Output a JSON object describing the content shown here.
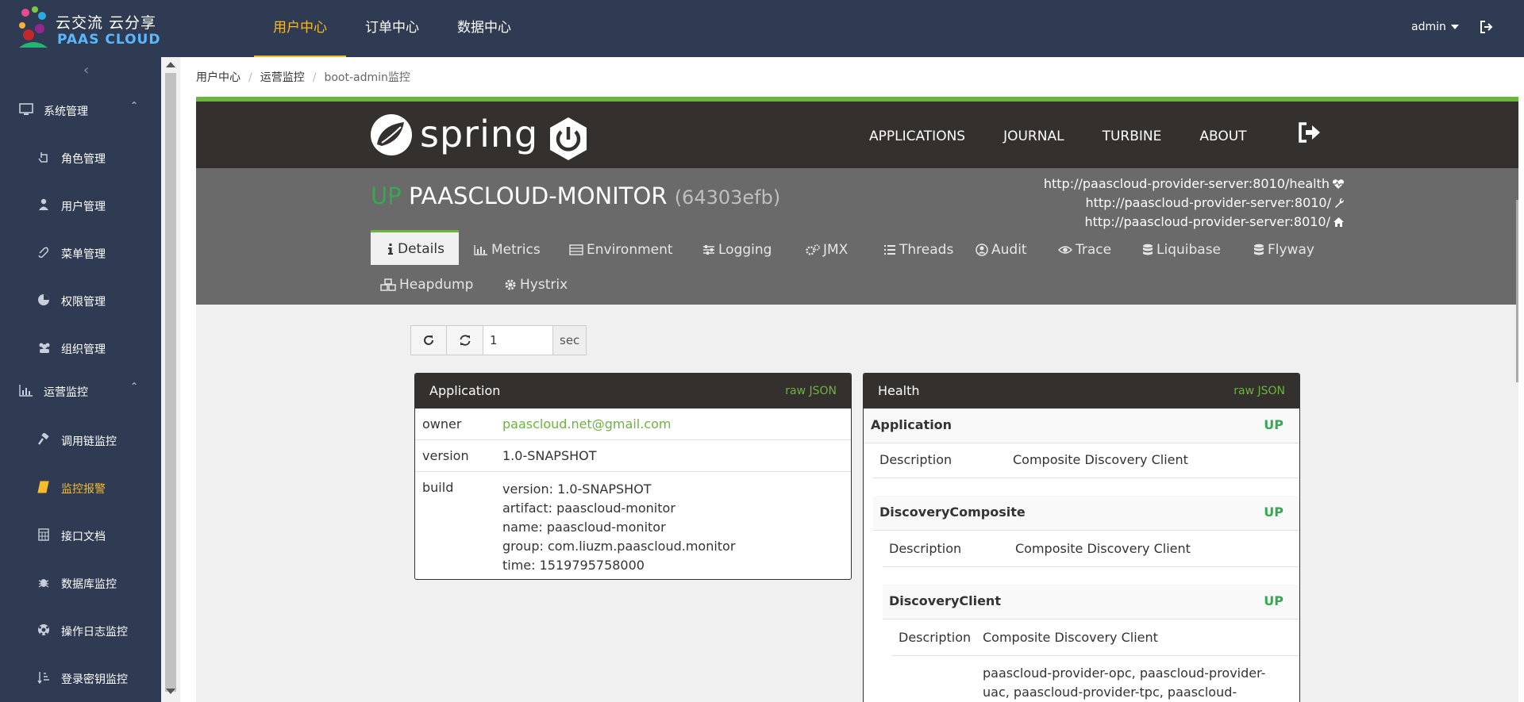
{
  "brand": {
    "line1": "云交流 云分享",
    "line2": "PAAS CLOUD"
  },
  "topnav": [
    "用户中心",
    "订单中心",
    "数据中心"
  ],
  "user": {
    "name": "admin"
  },
  "sidebar": {
    "groups": [
      {
        "label": "系统管理",
        "icon": "monitor-icon"
      },
      {
        "label": "运营监控",
        "icon": "bar-chart-icon"
      }
    ],
    "items": [
      {
        "label": "角色管理",
        "icon": "hand-icon"
      },
      {
        "label": "用户管理",
        "icon": "user-icon"
      },
      {
        "label": "菜单管理",
        "icon": "paperclip-icon"
      },
      {
        "label": "权限管理",
        "icon": "pie-icon"
      },
      {
        "label": "组织管理",
        "icon": "group-icon"
      },
      {
        "label": "调用链监控",
        "icon": "gavel-icon"
      },
      {
        "label": "监控报警",
        "icon": "book-icon"
      },
      {
        "label": "接口文档",
        "icon": "calculator-icon"
      },
      {
        "label": "数据库监控",
        "icon": "bug-icon"
      },
      {
        "label": "操作日志监控",
        "icon": "futbol-icon"
      },
      {
        "label": "登录密钥监控",
        "icon": "sort-icon"
      }
    ]
  },
  "breadcrumb": [
    "用户中心",
    "运营监控",
    "boot-admin监控"
  ],
  "sba": {
    "logo_text": "spring",
    "nav": [
      "APPLICATIONS",
      "JOURNAL",
      "TURBINE",
      "ABOUT"
    ],
    "status": "UP",
    "app_name": "PAASCLOUD-MONITOR",
    "app_id": "(64303efb)",
    "urls": [
      "http://paascloud-provider-server:8010/health",
      "http://paascloud-provider-server:8010/",
      "http://paascloud-provider-server:8010/"
    ],
    "tabs": [
      "Details",
      "Metrics",
      "Environment",
      "Logging",
      "JMX",
      "Threads",
      "Audit",
      "Trace",
      "Liquibase",
      "Flyway",
      "Heapdump",
      "Hystrix"
    ],
    "refresh_interval": "1",
    "refresh_unit": "sec",
    "application": {
      "title": "Application",
      "raw": "raw JSON",
      "rows": [
        {
          "key": "owner",
          "value": "paascloud.net@gmail.com"
        },
        {
          "key": "version",
          "value": "1.0-SNAPSHOT"
        }
      ],
      "build_key": "build",
      "build_lines": [
        "version: 1.0-SNAPSHOT",
        "artifact: paascloud-monitor",
        "name: paascloud-monitor",
        "group: com.liuzm.paascloud.monitor",
        "time: 1519795758000"
      ]
    },
    "health": {
      "title": "Health",
      "raw": "raw JSON",
      "rows": [
        {
          "key": "Application",
          "value": "UP"
        },
        {
          "key": "Description",
          "value": "Composite Discovery Client"
        },
        {
          "key": "DiscoveryComposite",
          "value": "UP"
        },
        {
          "key": "Description",
          "value": "Composite Discovery Client"
        },
        {
          "key": "DiscoveryClient",
          "value": "UP"
        },
        {
          "key": "Description",
          "value": "Composite Discovery Client"
        }
      ],
      "services_lines": [
        "paascloud-provider-opc, paascloud-provider-",
        "uac, paascloud-provider-tpc, paascloud-"
      ]
    }
  },
  "colors": {
    "sidebar_bg": "#2f3b52",
    "accent": "#f7ba2a",
    "spring_green": "#6db33f",
    "up_green": "#34a853"
  }
}
